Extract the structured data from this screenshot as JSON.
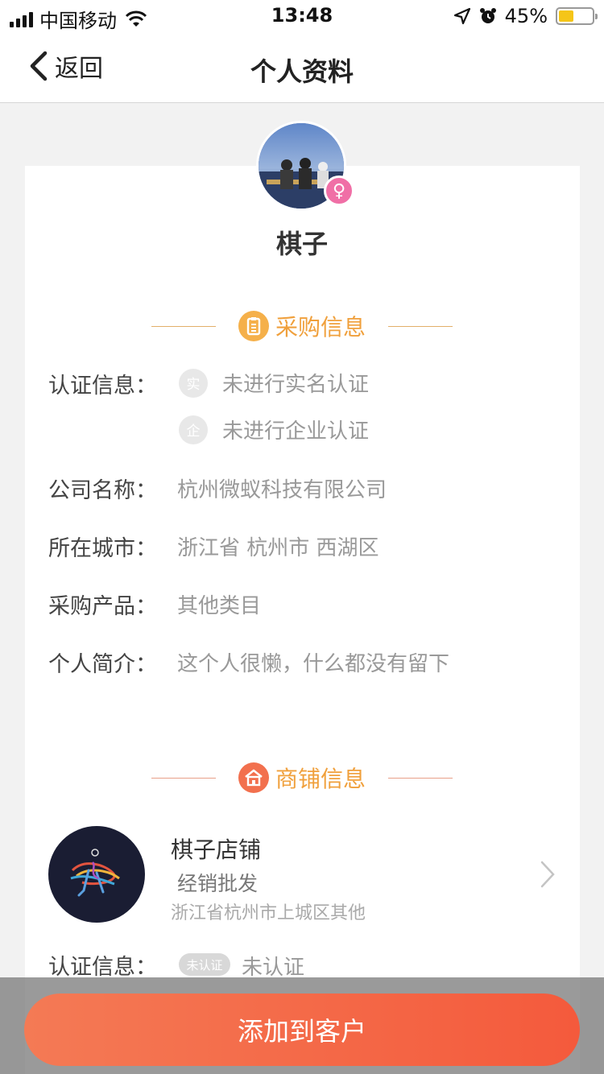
{
  "status_bar": {
    "carrier": "中国移动",
    "time": "13:48",
    "battery_pct": "45%",
    "battery_level": 0.45,
    "icons": [
      "signal-icon",
      "wifi-icon",
      "location-icon",
      "alarm-icon",
      "battery-icon"
    ]
  },
  "nav": {
    "back_label": "返回",
    "title": "个人资料"
  },
  "profile": {
    "nickname": "棋子",
    "gender_symbol": "♀"
  },
  "purchase_section": {
    "title": "采购信息",
    "cert_label": "认证信息：",
    "cert_items": [
      {
        "badge": "实",
        "text": "未进行实名认证"
      },
      {
        "badge": "企",
        "text": "未进行企业认证"
      }
    ],
    "rows": [
      {
        "label": "公司名称：",
        "value": "杭州微蚁科技有限公司"
      },
      {
        "label": "所在城市：",
        "value": "浙江省 杭州市 西湖区"
      },
      {
        "label": "采购产品：",
        "value": "其他类目"
      },
      {
        "label": "个人简介：",
        "value": "这个人很懒，什么都没有留下"
      }
    ]
  },
  "shop_section": {
    "title": "商铺信息",
    "shop_name": "棋子店铺",
    "shop_type": "经销批发",
    "shop_address": "浙江省杭州市上城区其他",
    "cert_label": "认证信息：",
    "cert_badge": "未认证",
    "cert_text": "未认证"
  },
  "actions": {
    "add_button": "添加到客户"
  },
  "colors": {
    "accent_orange": "#f0a03c",
    "button_start": "#f47a55",
    "button_end": "#f45a3c",
    "gender_pink": "#f06fa6"
  }
}
